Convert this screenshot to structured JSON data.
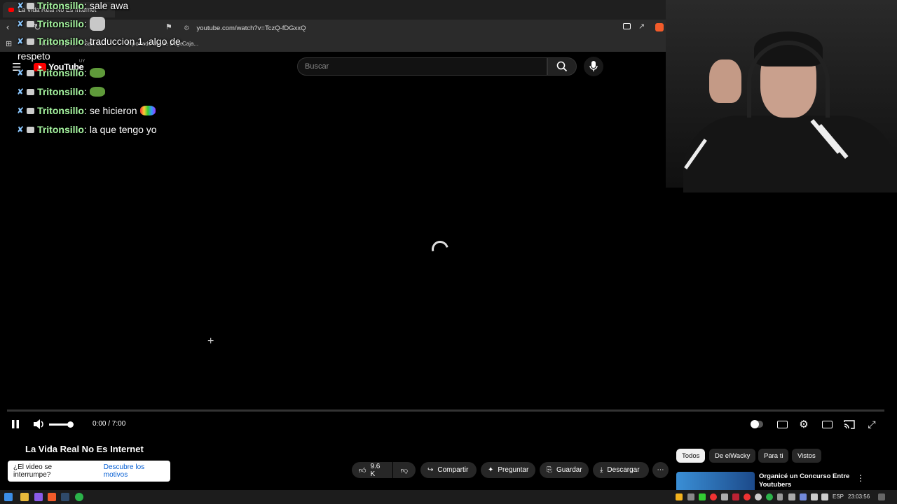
{
  "browser": {
    "tab_title": "La Vida Real No Es Internet",
    "url": "youtube.com/watch?v=TczQ-fDGxxQ",
    "bookmarks": [
      "Nueva carpeta",
      "Sala de...",
      "Importado desde Edge",
      "Caja..."
    ]
  },
  "youtube": {
    "logo_text": "YouTube",
    "country": "UY",
    "search_placeholder": "Buscar"
  },
  "chat": [
    {
      "user": "Tritonsillo",
      "sep": ":",
      "text": "sale awa"
    },
    {
      "user": "Tritonsillo",
      "sep": ":",
      "text": "",
      "emote": "cat-emote"
    },
    {
      "user": "Tritonsillo",
      "sep": ":",
      "text": "traduccion 1. algo de"
    },
    {
      "user": "",
      "sep": "",
      "text": "respeto"
    },
    {
      "user": "Tritonsillo",
      "sep": ":",
      "text": "",
      "emote": "pepe-emote"
    },
    {
      "user": "Tritonsillo",
      "sep": ":",
      "text": "",
      "emote": "pepe-emote"
    },
    {
      "user": "Tritonsillo",
      "sep": ":",
      "text": "se hicieron",
      "emote": "rainbow-pepe-emote"
    },
    {
      "user": "Tritonsillo",
      "sep": ":",
      "text": "la que tengo yo"
    }
  ],
  "player": {
    "time": "0:00 / 7:00",
    "progress_fraction": 0.0,
    "volume_fraction": 1.0
  },
  "video": {
    "title": "La Vida Real No Es Internet",
    "likes": "9.6 K",
    "share_label": "Compartir",
    "ask_label": "Preguntar",
    "save_label": "Guardar",
    "download_label": "Descargar"
  },
  "toast": {
    "question": "¿El video se interrumpe?",
    "link": "Descubre los motivos"
  },
  "chips": [
    "Todos",
    "De elWacky",
    "Para ti",
    "Vistos"
  ],
  "recommendation": {
    "title": "Organicé un Concurso Entre Youtubers"
  },
  "taskbar": {
    "lang": "ESP",
    "clock": "23:03:56"
  },
  "colors": {
    "chat_username": "#a6f5a0",
    "link_blue": "#065fd4",
    "youtube_red": "#ff0000"
  }
}
